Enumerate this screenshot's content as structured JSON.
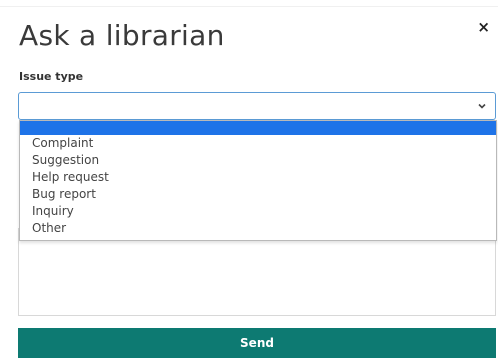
{
  "dialog": {
    "title": "Ask a librarian",
    "close_label": "×"
  },
  "form": {
    "issue_type_label": "Issue type",
    "issue_type_value": "",
    "send_label": "Send"
  },
  "dropdown": {
    "options": [
      "",
      "Complaint",
      "Suggestion",
      "Help request",
      "Bug report",
      "Inquiry",
      "Other"
    ],
    "highlighted_index": 0
  },
  "colors": {
    "accent": "#0d7a72",
    "highlight": "#1e73e8",
    "focus_border": "#5b9bd5"
  },
  "icons": {
    "close": "close-icon",
    "dropdown": "chevron-down-icon"
  }
}
